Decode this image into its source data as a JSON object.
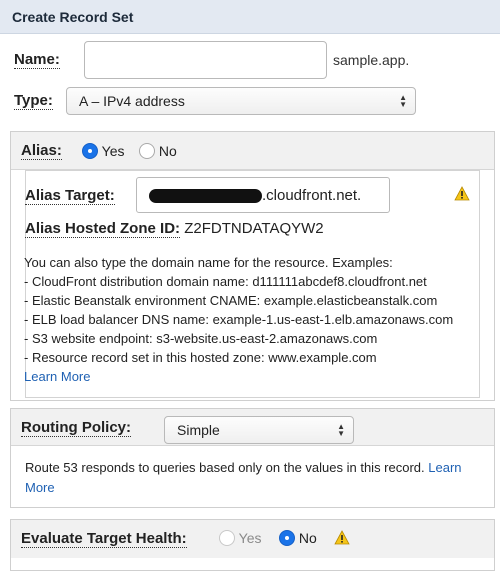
{
  "header": {
    "title": "Create Record Set"
  },
  "name": {
    "label": "Name:",
    "value": "",
    "suffix": "sample.app."
  },
  "type": {
    "label": "Type:",
    "selected": "A – IPv4 address"
  },
  "alias": {
    "label": "Alias:",
    "yes_label": "Yes",
    "no_label": "No",
    "selected": "Yes",
    "target_label": "Alias Target:",
    "target_value": ".cloudfront.net.",
    "zone_label": "Alias Hosted Zone ID:",
    "zone_value": "Z2FDTNDATAQYW2",
    "help_intro": "You can also type the domain name for the resource. Examples:",
    "help_examples": [
      "- CloudFront distribution domain name: d111111abcdef8.cloudfront.net",
      "- Elastic Beanstalk environment CNAME: example.elasticbeanstalk.com",
      "- ELB load balancer DNS name: example-1.us-east-1.elb.amazonaws.com",
      "- S3 website endpoint: s3-website.us-east-2.amazonaws.com",
      "- Resource record set in this hosted zone: www.example.com"
    ],
    "learn_more": "Learn More"
  },
  "routing": {
    "label": "Routing Policy:",
    "selected": "Simple",
    "description": "Route 53 responds to queries based only on the values in this record.",
    "learn": "Learn",
    "more": "More"
  },
  "health": {
    "label": "Evaluate Target Health:",
    "yes_label": "Yes",
    "no_label": "No",
    "selected": "No"
  },
  "colors": {
    "accent": "#1a73e8",
    "header_bg": "#e3e9f2",
    "link": "#1f61b3",
    "warning": "#f5c518"
  },
  "icons": {
    "warning": "warning-icon",
    "select_arrows": "select-arrows-icon"
  }
}
